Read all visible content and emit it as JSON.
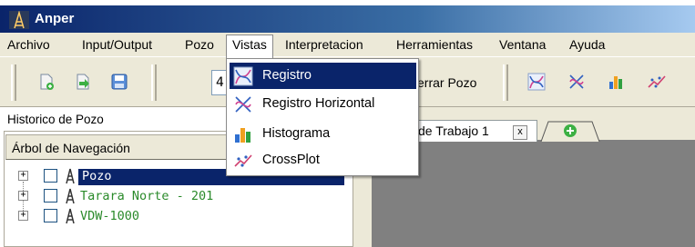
{
  "window": {
    "title": "Anper",
    "icon": "oil-derrick-icon"
  },
  "menubar": {
    "items": [
      "Archivo",
      "Input/Output",
      "Pozo",
      "Vistas",
      "Interpretacion",
      "Herramientas",
      "Ventana",
      "Ayuda"
    ],
    "active": "Vistas"
  },
  "vistas_menu": {
    "items": [
      {
        "label": "Registro",
        "icon": "log-curve-icon",
        "highlighted": true
      },
      {
        "label": "Registro Horizontal",
        "icon": "horizontal-log-icon",
        "highlighted": false
      },
      {
        "label": "Histograma",
        "icon": "histogram-icon",
        "highlighted": false
      },
      {
        "label": "CrossPlot",
        "icon": "crossplot-icon",
        "highlighted": false
      }
    ]
  },
  "toolbar": {
    "icons": [
      "new-document-icon",
      "import-arrow-icon",
      "save-disk-icon"
    ],
    "combo_partial_value": "4",
    "cerrar_pozo_partial": "errar Pozo",
    "view_icons": [
      "log-curve-icon",
      "horizontal-log-icon",
      "histogram-icon",
      "crossplot-icon"
    ]
  },
  "left_panel": {
    "title": "Historico de Pozo",
    "tree_header": "Árbol de Navegación",
    "tree": [
      {
        "label": "Pozo",
        "selected": true,
        "color": "#000000"
      },
      {
        "label": "Tarara Norte - 201",
        "selected": false,
        "color": "#2a8a2a"
      },
      {
        "label": "VDW-1000",
        "selected": false,
        "color": "#2a8a2a"
      }
    ]
  },
  "workspace": {
    "tab_label_partial": "de Trabajo 1",
    "tab_close": "x",
    "add_tab_icon": "add-tab-icon"
  },
  "colors": {
    "selection": "#0a246a",
    "chrome": "#ece9d8",
    "workarea": "#808080"
  }
}
